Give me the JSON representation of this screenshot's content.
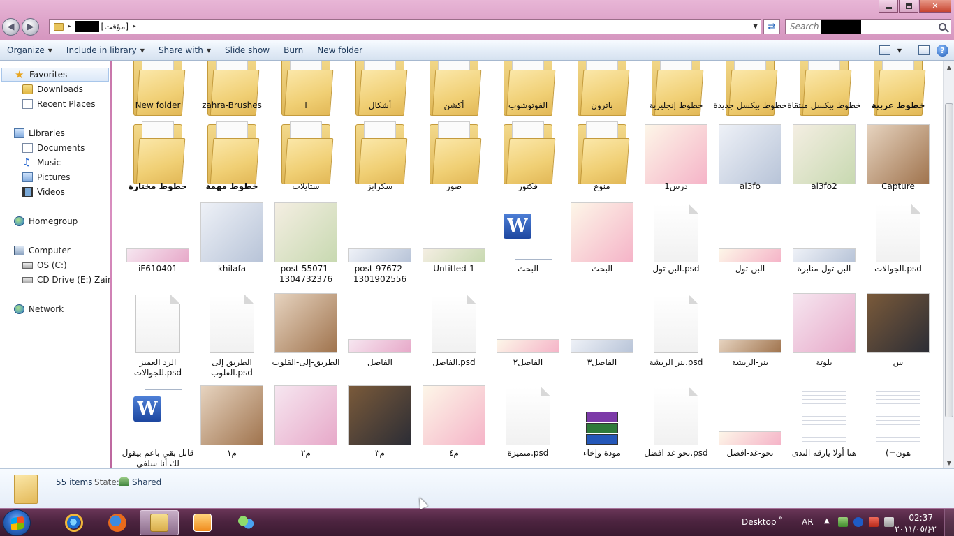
{
  "window": {
    "minimize_glyph": "",
    "close_glyph": "✕"
  },
  "address": {
    "breadcrumb": "[مؤقت]",
    "sep": "▸"
  },
  "search": {
    "placeholder": "Search"
  },
  "toolbar": {
    "organize": "Organize",
    "include": "Include in library",
    "share": "Share with",
    "slideshow": "Slide show",
    "burn": "Burn",
    "newfolder": "New folder",
    "help": "?"
  },
  "nav": {
    "favorites": "Favorites",
    "downloads": "Downloads",
    "recent": "Recent Places",
    "libraries": "Libraries",
    "documents": "Documents",
    "music": "Music",
    "pictures": "Pictures",
    "videos": "Videos",
    "homegroup": "Homegroup",
    "computer": "Computer",
    "osc": "OS (C:)",
    "cddrive": "CD Drive (E:) Zain US",
    "network": "Network"
  },
  "rows": [
    [
      {
        "label": "New folder",
        "type": "folder"
      },
      {
        "label": "zahra-Brushes",
        "type": "folder"
      },
      {
        "label": "ا",
        "type": "folder"
      },
      {
        "label": "أشكال",
        "type": "folder"
      },
      {
        "label": "أكشن",
        "type": "folder"
      },
      {
        "label": "الفوتوشوب",
        "type": "folder"
      },
      {
        "label": "باترون",
        "type": "folder"
      },
      {
        "label": "خطوط إنجليزية",
        "type": "folder"
      },
      {
        "label": "خطوط بيكسل جديدة",
        "type": "folder"
      },
      {
        "label": "خطوط بيكسل منتقاة",
        "type": "folder"
      },
      {
        "label": "خطوط عربية",
        "type": "folder",
        "bold": true
      }
    ],
    [
      {
        "label": "خطوط مختارة",
        "type": "folder",
        "bold": true
      },
      {
        "label": "خطوط مهمة",
        "type": "folder",
        "bold": true
      },
      {
        "label": "ستايلات",
        "type": "folder"
      },
      {
        "label": "سكرابز",
        "type": "folder"
      },
      {
        "label": "صور",
        "type": "folder"
      },
      {
        "label": "فكتور",
        "type": "folder"
      },
      {
        "label": "منوع",
        "type": "folder"
      },
      {
        "label": "درس1",
        "type": "picture"
      },
      {
        "label": "al3fo",
        "type": "picture"
      },
      {
        "label": "al3fo2",
        "type": "picture"
      },
      {
        "label": "Capture",
        "type": "picture"
      }
    ],
    [
      {
        "label": "iF610401",
        "type": "banner"
      },
      {
        "label": "khilafa",
        "type": "picture"
      },
      {
        "label": "post-55071-1304732376",
        "type": "picture"
      },
      {
        "label": "post-97672-1301902556",
        "type": "banner"
      },
      {
        "label": "Untitled-1",
        "type": "banner"
      },
      {
        "label": "البحث",
        "type": "word"
      },
      {
        "label": "البحث",
        "type": "picture"
      },
      {
        "label": "البن تول.psd",
        "type": "file"
      },
      {
        "label": "البن-تول",
        "type": "banner"
      },
      {
        "label": "البن-تول-منابرة",
        "type": "banner"
      },
      {
        "label": "الجوالات.psd",
        "type": "file"
      }
    ],
    [
      {
        "label": "الرد العميز للجوالات.psd",
        "type": "file"
      },
      {
        "label": "الطريق إلى القلوب.psd",
        "type": "file"
      },
      {
        "label": "الطريق-إلى-القلوب",
        "type": "picture"
      },
      {
        "label": "الفاصل",
        "type": "banner"
      },
      {
        "label": "الفاصل.psd",
        "type": "file"
      },
      {
        "label": "الفاصل٢",
        "type": "banner"
      },
      {
        "label": "الفاصل٣",
        "type": "banner"
      },
      {
        "label": "بنر الريشة.psd",
        "type": "file"
      },
      {
        "label": "بنر-الريشة",
        "type": "banner"
      },
      {
        "label": "بلوتة",
        "type": "picture"
      },
      {
        "label": "س",
        "type": "picture"
      }
    ],
    [
      {
        "label": "قابل بقي باعم بيقول لك أنا سلفي",
        "type": "word"
      },
      {
        "label": "م١",
        "type": "picture"
      },
      {
        "label": "م٢",
        "type": "picture"
      },
      {
        "label": "م٣",
        "type": "picture"
      },
      {
        "label": "م٤",
        "type": "picture"
      },
      {
        "label": "متميزة.psd",
        "type": "file"
      },
      {
        "label": "مودة وإخاء",
        "type": "rar"
      },
      {
        "label": "نحو غد افضل.psd",
        "type": "file"
      },
      {
        "label": "نحو-غد-افضل",
        "type": "banner"
      },
      {
        "label": "هنا أولا يارقة الندى",
        "type": "text"
      },
      {
        "label": "(=هون",
        "type": "text"
      }
    ]
  ],
  "details": {
    "count": "55 items",
    "state_label": "State:",
    "state_value": "Shared"
  },
  "taskbar": {
    "desktop": "Desktop",
    "chevron": "»",
    "lang": "AR",
    "tray_up": "▲",
    "time": "02:37 م",
    "date": "٢٠١١/٠٥/١٢"
  }
}
